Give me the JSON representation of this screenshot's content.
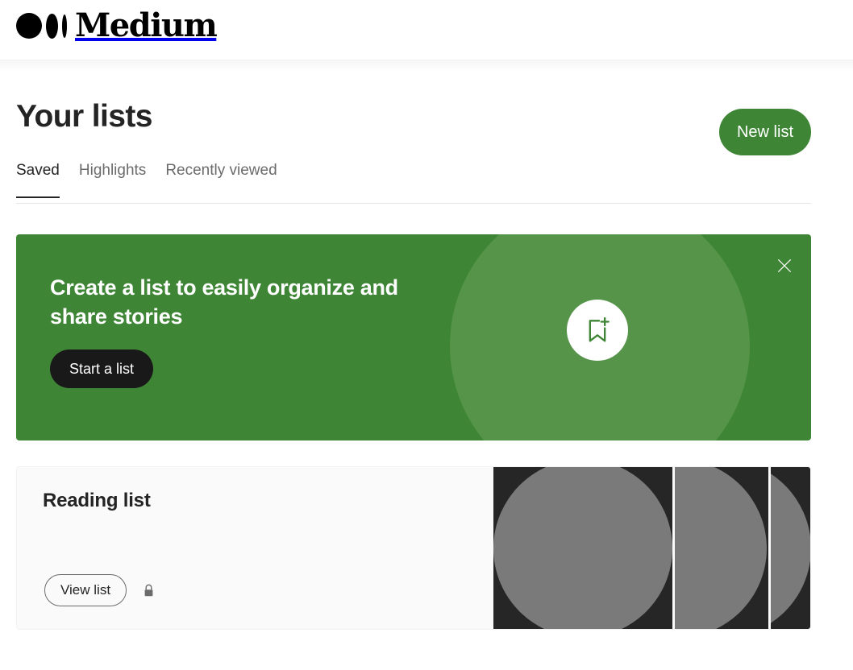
{
  "header": {
    "logo_text": "Medium",
    "logo_icon": "medium-logo-marks"
  },
  "page": {
    "title": "Your lists",
    "new_list_label": "New list"
  },
  "tabs": [
    {
      "label": "Saved",
      "active": true
    },
    {
      "label": "Highlights",
      "active": false
    },
    {
      "label": "Recently viewed",
      "active": false
    }
  ],
  "promo": {
    "heading": "Create a list to easily organize and share stories",
    "cta_label": "Start a list",
    "icon": "bookmark-plus-icon",
    "close_icon": "close-icon",
    "bg_color": "#3e8635",
    "circle_color": "#56944a",
    "cta_bg_color": "#191919"
  },
  "lists": [
    {
      "title": "Reading list",
      "view_label": "View list",
      "privacy_icon": "lock-icon",
      "thumbnails": [
        {
          "bg_color": "#262626",
          "shape": "circle",
          "shape_color": "#7a7a7a"
        },
        {
          "bg_color": "#262626",
          "shape": "circle",
          "shape_color": "#7a7a7a"
        },
        {
          "bg_color": "#262626",
          "shape": "circle",
          "shape_color": "#7a7a7a"
        }
      ]
    }
  ]
}
